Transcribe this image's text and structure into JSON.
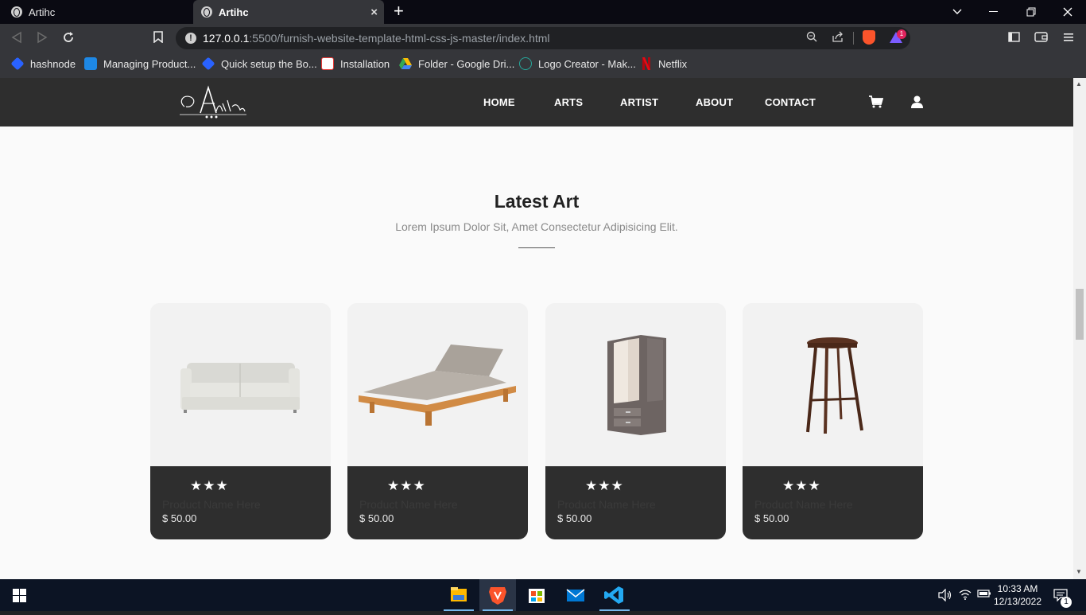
{
  "browser": {
    "tabs": [
      {
        "title": "Artihc",
        "active": false
      },
      {
        "title": "Artihc",
        "active": true
      }
    ],
    "new_tab_symbol": "+",
    "close_symbol": "×",
    "url_host": "127.0.0.1",
    "url_rest": ":5500/furnish-website-template-html-css-js-master/index.html",
    "rewards_badge": "1",
    "bookmarks": [
      {
        "label": "hashnode",
        "icon": "hashnode-icon",
        "color": "#2962ff"
      },
      {
        "label": "Managing Product...",
        "icon": "product-icon",
        "color": "#1e88e5"
      },
      {
        "label": "Quick setup the Bo...",
        "icon": "diamond-icon",
        "color": "#2962ff"
      },
      {
        "label": "Installation",
        "icon": "installation-icon",
        "color": "#e53935"
      },
      {
        "label": "Folder - Google Dri...",
        "icon": "google-drive-icon",
        "color": "#34a853"
      },
      {
        "label": "Logo Creator - Mak...",
        "icon": "logo-creator-icon",
        "color": "#26a69a"
      },
      {
        "label": "Netflix",
        "icon": "netflix-icon",
        "color": "#e50914"
      }
    ]
  },
  "site": {
    "nav": [
      "HOME",
      "ARTS",
      "ARTIST",
      "ABOUT",
      "CONTACT"
    ],
    "section_title": "Latest Art",
    "section_subtitle": "Lorem Ipsum Dolor Sit, Amet Consectetur Adipisicing Elit.",
    "products": [
      {
        "image": "sofa",
        "rating": 3,
        "stars": "★★★",
        "name": "Product Name Here",
        "price": "$ 50.00"
      },
      {
        "image": "lounger",
        "rating": 3,
        "stars": "★★★",
        "name": "Product Name Here",
        "price": "$ 50.00"
      },
      {
        "image": "wardrobe",
        "rating": 3,
        "stars": "★★★",
        "name": "Product Name Here",
        "price": "$ 50.00"
      },
      {
        "image": "bar-stool",
        "rating": 3,
        "stars": "★★★",
        "name": "Product Name Here",
        "price": "$ 50.00"
      }
    ],
    "colors": {
      "header": "#2e2e2e",
      "page_bg": "#fafafa",
      "card_bg": "#f2f2f2"
    }
  },
  "taskbar": {
    "time": "10:33 AM",
    "date": "12/13/2022",
    "notification_count": "1",
    "apps": [
      "file-explorer",
      "brave",
      "microsoft-store",
      "mail",
      "vs-code"
    ]
  }
}
